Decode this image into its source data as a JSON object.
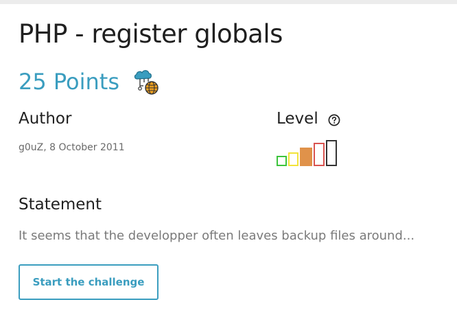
{
  "challenge": {
    "title": "PHP - register globals",
    "points": "25 Points",
    "category_icon": "cloud-network-globe-icon"
  },
  "author": {
    "label": "Author",
    "info": "g0uZ,  8 October 2011"
  },
  "level": {
    "label": "Level",
    "help_icon": "question-circle-icon",
    "current": 4,
    "max": 5,
    "colors": [
      "#3cc43c",
      "#f2e33a",
      "#e0924a",
      "#d9534f",
      "#333333"
    ]
  },
  "statement": {
    "label": "Statement",
    "text": "It seems that the developper often leaves backup files around..."
  },
  "actions": {
    "start_label": "Start the challenge"
  },
  "theme": {
    "accent": "#3a9dbf"
  }
}
